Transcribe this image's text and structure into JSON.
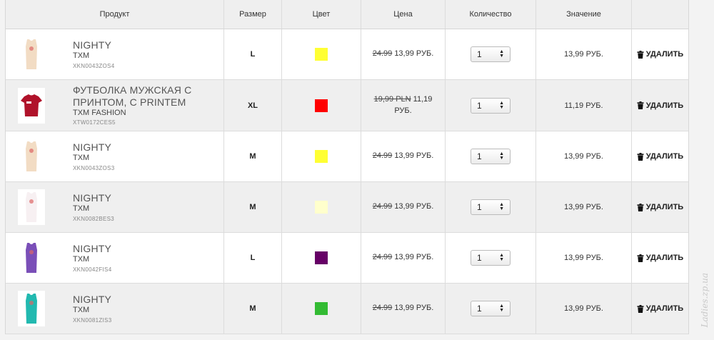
{
  "headers": {
    "product": "Продукт",
    "size": "Размер",
    "color": "Цвет",
    "price": "Цена",
    "quantity": "Количество",
    "total": "Значение"
  },
  "items": [
    {
      "name": "NIGHTY",
      "brand": "TXM",
      "sku": "XKN0043ZOS4",
      "size": "L",
      "color": "#ffff33",
      "price_old": "24.99",
      "price_new": "13,99 РУБ.",
      "qty": "1",
      "total": "13,99 РУБ.",
      "delete": "УДАЛИТЬ",
      "image": "nightgown-beige-icon",
      "image_color": "#f2dcc4"
    },
    {
      "name": "ФУТБОЛКА МУЖСКАЯ С ПРИНТОМ, С PRINTEM",
      "brand": "TXM FASHION",
      "sku": "XTW0172CES5",
      "size": "XL",
      "color": "#ff0000",
      "price_old": "19,99 PLN",
      "price_new": "11,19 РУБ.",
      "qty": "1",
      "total": "11,19 РУБ.",
      "delete": "УДАЛИТЬ",
      "image": "tshirt-red-icon",
      "image_color": "#b0122a"
    },
    {
      "name": "NIGHTY",
      "brand": "TXM",
      "sku": "XKN0043ZOS3",
      "size": "M",
      "color": "#ffff33",
      "price_old": "24.99",
      "price_new": "13,99 РУБ.",
      "qty": "1",
      "total": "13,99 РУБ.",
      "delete": "УДАЛИТЬ",
      "image": "nightgown-beige-icon",
      "image_color": "#f2dcc4"
    },
    {
      "name": "NIGHTY",
      "brand": "TXM",
      "sku": "XKN0082BES3",
      "size": "M",
      "color": "#ffffcc",
      "price_old": "24.99",
      "price_new": "13,99 РУБ.",
      "qty": "1",
      "total": "13,99 РУБ.",
      "delete": "УДАЛИТЬ",
      "image": "nightgown-floral-icon",
      "image_color": "#f7f0f2"
    },
    {
      "name": "NIGHTY",
      "brand": "TXM",
      "sku": "XKN0042FIS4",
      "size": "L",
      "color": "#660066",
      "price_old": "24.99",
      "price_new": "13,99 РУБ.",
      "qty": "1",
      "total": "13,99 РУБ.",
      "delete": "УДАЛИТЬ",
      "image": "nightgown-purple-icon",
      "image_color": "#7a4fb8"
    },
    {
      "name": "NIGHTY",
      "brand": "TXM",
      "sku": "XKN0081ZIS3",
      "size": "M",
      "color": "#33bb33",
      "price_old": "24.99",
      "price_new": "13,99 РУБ.",
      "qty": "1",
      "total": "13,99 РУБ.",
      "delete": "УДАЛИТЬ",
      "image": "nightgown-teal-icon",
      "image_color": "#22b9b0"
    }
  ],
  "watermark": "Ladies.zp.ua"
}
